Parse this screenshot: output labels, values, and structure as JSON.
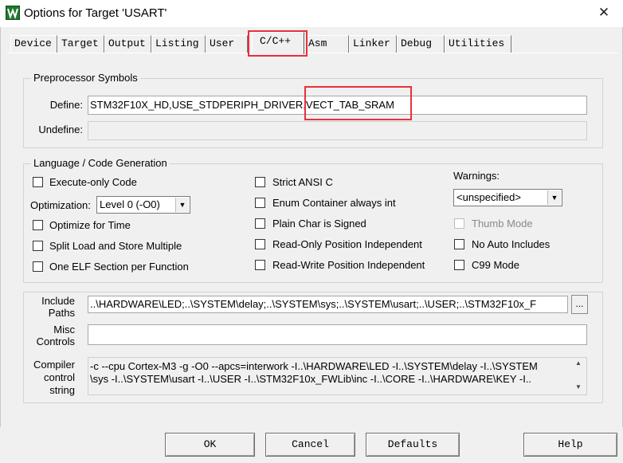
{
  "window": {
    "title": "Options for Target 'USART'",
    "close_glyph": "✕",
    "icon": "keil-uvision-icon"
  },
  "tabs": [
    {
      "label": "Device"
    },
    {
      "label": "Target"
    },
    {
      "label": "Output"
    },
    {
      "label": "Listing"
    },
    {
      "label": "User"
    },
    {
      "label": "C/C++",
      "active": true
    },
    {
      "label": "Asm"
    },
    {
      "label": "Linker"
    },
    {
      "label": "Debug"
    },
    {
      "label": "Utilities"
    }
  ],
  "preprocessor": {
    "group_title": "Preprocessor Symbols",
    "define_label": "Define:",
    "define_value": "STM32F10X_HD,USE_STDPERIPH_DRIVER,VECT_TAB_SRAM",
    "undefine_label": "Undefine:",
    "undefine_value": ""
  },
  "language": {
    "group_title": "Language / Code Generation",
    "execute_only": "Execute-only Code",
    "optimization_label": "Optimization:",
    "optimization_value": "Level 0 (-O0)",
    "optimize_time": "Optimize for Time",
    "split_load_store": "Split Load and Store Multiple",
    "one_elf_section": "One ELF Section per Function",
    "strict_ansi": "Strict ANSI C",
    "enum_int": "Enum Container always int",
    "plain_char": "Plain Char is Signed",
    "ro_pos_indep": "Read-Only Position Independent",
    "rw_pos_indep": "Read-Write Position Independent",
    "warnings_label": "Warnings:",
    "warnings_value": "<unspecified>",
    "thumb_mode": "Thumb Mode",
    "no_auto_includes": "No Auto Includes",
    "c99_mode": "C99 Mode"
  },
  "include": {
    "label_line1": "Include",
    "label_line2": "Paths",
    "value": "..\\HARDWARE\\LED;..\\SYSTEM\\delay;..\\SYSTEM\\sys;..\\SYSTEM\\usart;..\\USER;..\\STM32F10x_F",
    "browse_label": "..."
  },
  "misc": {
    "label_line1": "Misc",
    "label_line2": "Controls",
    "value": ""
  },
  "compiler": {
    "label_line1": "Compiler",
    "label_line2": "control",
    "label_line3": "string",
    "value": "-c --cpu Cortex-M3 -g -O0 --apcs=interwork -I..\\HARDWARE\\LED -I..\\SYSTEM\\delay -I..\\SYSTEM\n\\sys -I..\\SYSTEM\\usart -I..\\USER -I..\\STM32F10x_FWLib\\inc -I..\\CORE -I..\\HARDWARE\\KEY -I.."
  },
  "buttons": {
    "ok": "OK",
    "cancel": "Cancel",
    "defaults": "Defaults",
    "help": "Help"
  },
  "colors": {
    "highlight": "#e8303a"
  }
}
